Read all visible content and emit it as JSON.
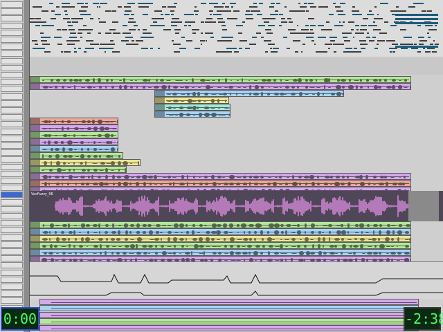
{
  "colors": {
    "green": "#b4e89a",
    "purple": "#d6a8ec",
    "blue": "#a8d4f4",
    "yellow": "#eee89a",
    "teal": "#a8e6d8",
    "red": "#e8a89a",
    "big_clip_bg": "#4f4658",
    "big_clip_wave": "#d68ad8",
    "counter_text": "#4cff6c"
  },
  "sidebar": {
    "strip_count": 46
  },
  "tracks": [
    {
      "color": "green"
    },
    {
      "color": "purple"
    },
    {
      "color": "blue"
    },
    {
      "color": "yellow"
    },
    {
      "color": "teal"
    },
    {
      "color": "blue"
    },
    {
      "color": "red"
    },
    {
      "color": "purple"
    },
    {
      "color": "green"
    },
    {
      "color": "purple"
    },
    {
      "color": "blue"
    },
    {
      "color": "green"
    },
    {
      "color": "yellow"
    },
    {
      "color": "green"
    },
    {
      "color": "purple"
    },
    {
      "color": "red"
    },
    {
      "color": "purple"
    },
    {
      "color": "green"
    },
    {
      "color": "blue"
    },
    {
      "color": "yellow"
    },
    {
      "color": "green"
    },
    {
      "color": "blue"
    },
    {
      "color": "purple"
    }
  ],
  "big_clip": {
    "name": "VocFuzzy_06"
  },
  "counters": {
    "left": "0:00",
    "right": "-2:38"
  }
}
